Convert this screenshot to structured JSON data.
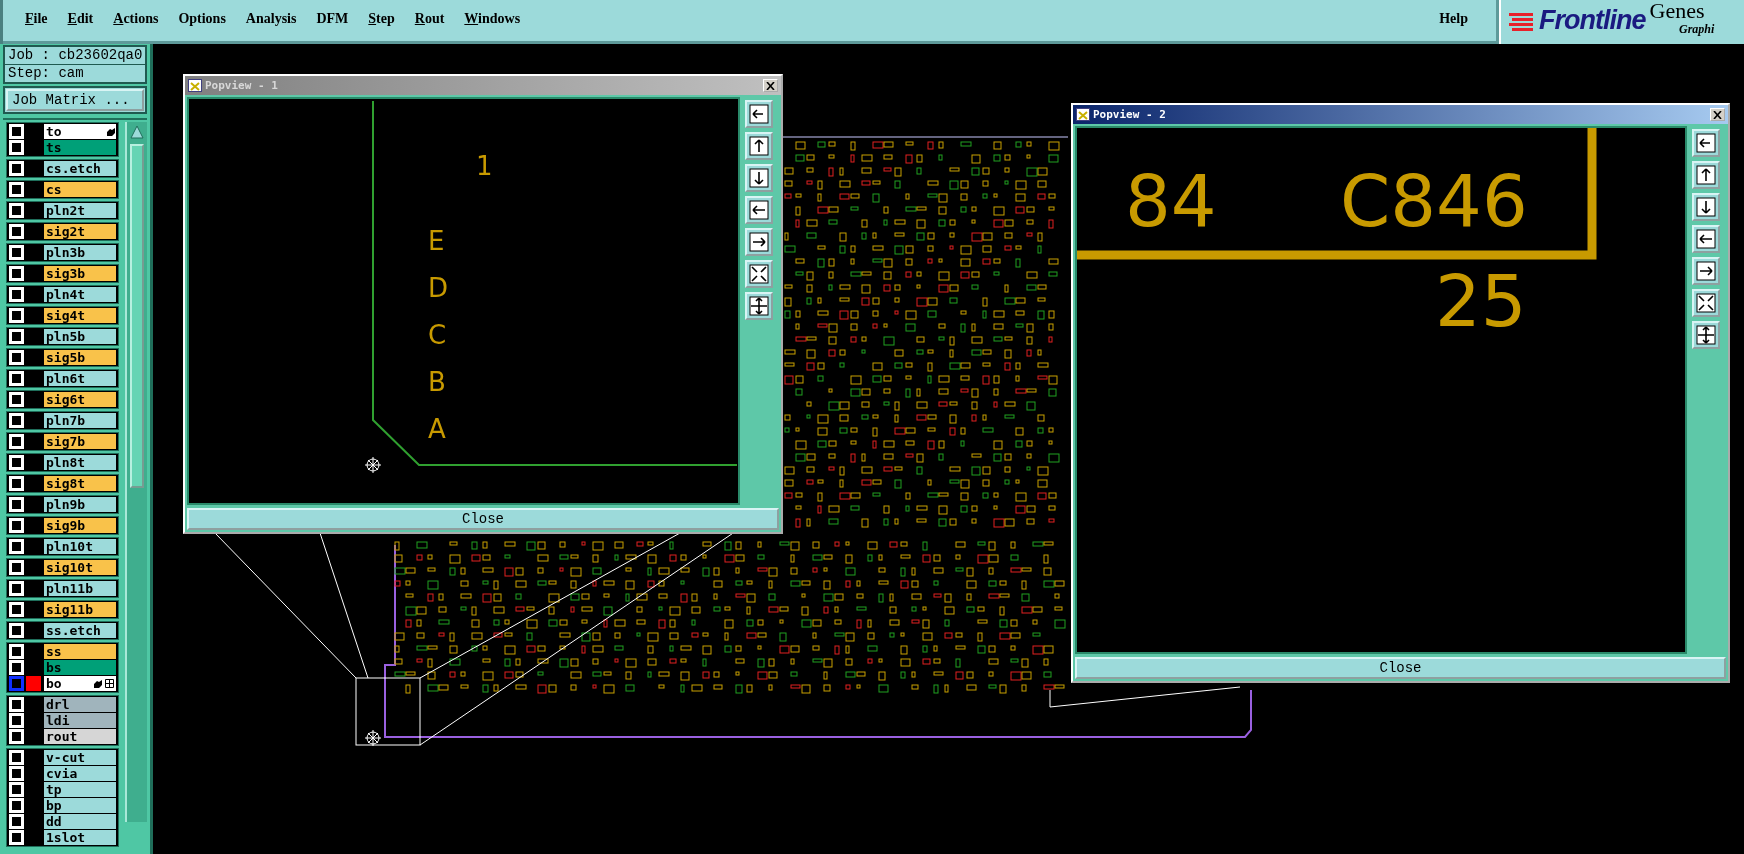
{
  "menu_bar": {
    "items": [
      {
        "label": "File",
        "underlined": true
      },
      {
        "label": "Edit",
        "underlined": true
      },
      {
        "label": "Actions",
        "underlined": true
      },
      {
        "label": "Options",
        "underlined": false
      },
      {
        "label": "Analysis",
        "underlined": false
      },
      {
        "label": "DFM",
        "underlined": false
      },
      {
        "label": "Step",
        "underlined": true
      },
      {
        "label": "Rout",
        "underlined": true
      },
      {
        "label": "Windows",
        "underlined": true
      }
    ],
    "help": "Help"
  },
  "logo": {
    "brand": "Frontline",
    "product": "Genes",
    "subtitle": "Graphi"
  },
  "sidebar": {
    "job": "Job : cb23602qa0",
    "step": "Step: cam",
    "job_matrix_button": "Job Matrix ...",
    "layer_groups": [
      {
        "layers": [
          {
            "name": "to",
            "color": "#ffffff",
            "checked": false,
            "pointer": true,
            "work": false
          },
          {
            "name": "ts",
            "color": "#00a078",
            "checked": false,
            "pointer": false,
            "work": false
          }
        ]
      },
      {
        "layers": [
          {
            "name": "cs.etch",
            "color": "#9cdada",
            "checked": false,
            "pointer": false,
            "work": false
          }
        ]
      },
      {
        "layers": [
          {
            "name": "cs",
            "color": "#f9c24a",
            "checked": false,
            "pointer": false,
            "work": false
          }
        ]
      },
      {
        "layers": [
          {
            "name": "pln2t",
            "color": "#9cdada",
            "checked": false,
            "pointer": false,
            "work": false
          }
        ]
      },
      {
        "layers": [
          {
            "name": "sig2t",
            "color": "#f9c24a",
            "checked": false,
            "pointer": false,
            "work": false
          }
        ]
      },
      {
        "layers": [
          {
            "name": "pln3b",
            "color": "#9cdada",
            "checked": false,
            "pointer": false,
            "work": false
          }
        ]
      },
      {
        "layers": [
          {
            "name": "sig3b",
            "color": "#f9c24a",
            "checked": false,
            "pointer": false,
            "work": false
          }
        ]
      },
      {
        "layers": [
          {
            "name": "pln4t",
            "color": "#9cdada",
            "checked": false,
            "pointer": false,
            "work": false
          }
        ]
      },
      {
        "layers": [
          {
            "name": "sig4t",
            "color": "#f9c24a",
            "checked": false,
            "pointer": false,
            "work": false
          }
        ]
      },
      {
        "layers": [
          {
            "name": "pln5b",
            "color": "#9cdada",
            "checked": false,
            "pointer": false,
            "work": false
          }
        ]
      },
      {
        "layers": [
          {
            "name": "sig5b",
            "color": "#f9c24a",
            "checked": false,
            "pointer": false,
            "work": false
          }
        ]
      },
      {
        "layers": [
          {
            "name": "pln6t",
            "color": "#9cdada",
            "checked": false,
            "pointer": false,
            "work": false
          }
        ]
      },
      {
        "layers": [
          {
            "name": "sig6t",
            "color": "#f9c24a",
            "checked": false,
            "pointer": false,
            "work": false
          }
        ]
      },
      {
        "layers": [
          {
            "name": "pln7b",
            "color": "#9cdada",
            "checked": false,
            "pointer": false,
            "work": false
          }
        ]
      },
      {
        "layers": [
          {
            "name": "sig7b",
            "color": "#f9c24a",
            "checked": false,
            "pointer": false,
            "work": false
          }
        ]
      },
      {
        "layers": [
          {
            "name": "pln8t",
            "color": "#9cdada",
            "checked": false,
            "pointer": false,
            "work": false
          }
        ]
      },
      {
        "layers": [
          {
            "name": "sig8t",
            "color": "#f9c24a",
            "checked": false,
            "pointer": false,
            "work": false
          }
        ]
      },
      {
        "layers": [
          {
            "name": "pln9b",
            "color": "#9cdada",
            "checked": false,
            "pointer": false,
            "work": false
          }
        ]
      },
      {
        "layers": [
          {
            "name": "sig9b",
            "color": "#f9c24a",
            "checked": false,
            "pointer": false,
            "work": false
          }
        ]
      },
      {
        "layers": [
          {
            "name": "pln10t",
            "color": "#9cdada",
            "checked": false,
            "pointer": false,
            "work": false
          }
        ]
      },
      {
        "layers": [
          {
            "name": "sig10t",
            "color": "#f9c24a",
            "checked": false,
            "pointer": false,
            "work": false
          }
        ]
      },
      {
        "layers": [
          {
            "name": "pln11b",
            "color": "#9cdada",
            "checked": false,
            "pointer": false,
            "work": false
          }
        ]
      },
      {
        "layers": [
          {
            "name": "sig11b",
            "color": "#f9c24a",
            "checked": false,
            "pointer": false,
            "work": false
          }
        ]
      },
      {
        "layers": [
          {
            "name": "ss.etch",
            "color": "#9cdada",
            "checked": false,
            "pointer": false,
            "work": false
          }
        ]
      },
      {
        "layers": [
          {
            "name": "ss",
            "color": "#f9c24a",
            "checked": false,
            "pointer": false,
            "work": false
          },
          {
            "name": "bs",
            "color": "#00a078",
            "checked": false,
            "pointer": false,
            "work": false
          },
          {
            "name": "bo",
            "color": "#ffffff",
            "checked": false,
            "pointer": true,
            "work": true
          }
        ]
      },
      {
        "layers": [
          {
            "name": "drl",
            "color": "#a0b4bc",
            "checked": false,
            "pointer": false,
            "work": false
          },
          {
            "name": "ldi",
            "color": "#a0b4bc",
            "checked": false,
            "pointer": false,
            "work": false
          },
          {
            "name": "rout",
            "color": "#d6d6d6",
            "checked": false,
            "pointer": false,
            "work": false
          }
        ]
      },
      {
        "layers": [
          {
            "name": "v-cut",
            "color": "#9cdada",
            "checked": false,
            "pointer": false,
            "work": false
          },
          {
            "name": "cvia",
            "color": "#9cdada",
            "checked": false,
            "pointer": false,
            "work": false
          },
          {
            "name": "tp",
            "color": "#9cdada",
            "checked": false,
            "pointer": false,
            "work": false
          },
          {
            "name": "bp",
            "color": "#9cdada",
            "checked": false,
            "pointer": false,
            "work": false
          },
          {
            "name": "dd",
            "color": "#9cdada",
            "checked": false,
            "pointer": false,
            "work": false
          },
          {
            "name": "1slot",
            "color": "#9cdada",
            "checked": false,
            "pointer": false,
            "work": false
          }
        ]
      }
    ]
  },
  "popviews": [
    {
      "title": "Popview - 1",
      "active": false,
      "close_button": "Close",
      "view_texts": [
        "1",
        "E",
        "D",
        "C",
        "B",
        "A"
      ]
    },
    {
      "title": "Popview - 2",
      "active": true,
      "close_button": "Close",
      "view_texts": [
        "84",
        "C846",
        "25"
      ]
    }
  ]
}
